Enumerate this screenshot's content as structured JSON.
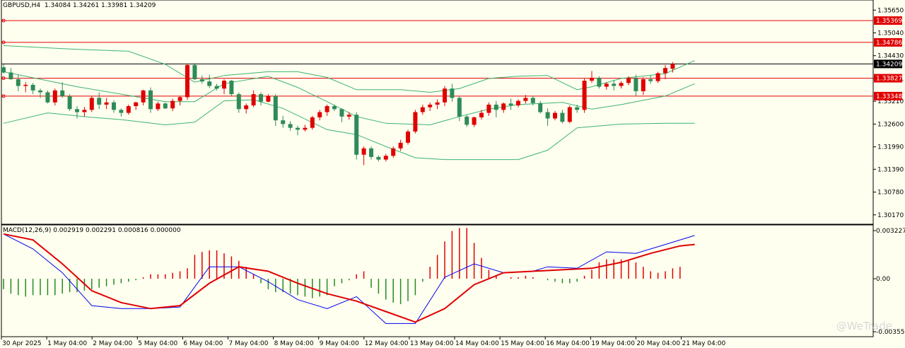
{
  "chart_data": {
    "type": "candlestick",
    "symbol_header": "GBPUSD,H4  1.34084 1.34261 1.33981 1.34209",
    "price_ticks": [
      "1.35650",
      "1.35040",
      "1.34430",
      "1.33821",
      "1.33210",
      "1.32600",
      "1.31990",
      "1.31390",
      "1.30780",
      "1.30170"
    ],
    "price_range": [
      1.2992,
      1.3592
    ],
    "x_labels": [
      "30 Apr 2025",
      "1 May 04:00",
      "2 May 04:00",
      "5 May 04:00",
      "6 May 04:00",
      "7 May 04:00",
      "8 May 04:00",
      "9 May 04:00",
      "12 May 04:00",
      "13 May 04:00",
      "14 May 04:00",
      "15 May 04:00",
      "16 May 04:00",
      "19 May 04:00",
      "20 May 04:00",
      "21 May 04:00"
    ],
    "horizontal_lines": [
      {
        "price": 1.35369,
        "label": "1.35369",
        "color": "#e00000"
      },
      {
        "price": 1.34786,
        "label": "1.34786",
        "color": "#e00000"
      },
      {
        "price": 1.33827,
        "label": "1.33827",
        "color": "#e00000"
      },
      {
        "price": 1.33348,
        "label": "1.33348",
        "color": "#e00000"
      }
    ],
    "current_price": {
      "price": 1.34209,
      "label": "1.34209"
    },
    "colors": {
      "bull": "#e00000",
      "bear": "#2e8b57",
      "band": "#3cb371",
      "macd_line": "#0000ee",
      "signal_line": "#e00000"
    },
    "candles": [
      [
        1.3412,
        1.342,
        1.3395,
        1.3398
      ],
      [
        1.3398,
        1.341,
        1.3378,
        1.338
      ],
      [
        1.338,
        1.3392,
        1.3348,
        1.3362
      ],
      [
        1.3362,
        1.3372,
        1.3345,
        1.3365
      ],
      [
        1.3365,
        1.337,
        1.334,
        1.335
      ],
      [
        1.335,
        1.3355,
        1.333,
        1.3345
      ],
      [
        1.3345,
        1.335,
        1.3315,
        1.3318
      ],
      [
        1.3318,
        1.3355,
        1.331,
        1.335
      ],
      [
        1.335,
        1.3372,
        1.333,
        1.3335
      ],
      [
        1.3335,
        1.334,
        1.3295,
        1.33
      ],
      [
        1.33,
        1.3308,
        1.3275,
        1.3292
      ],
      [
        1.3292,
        1.3306,
        1.328,
        1.3298
      ],
      [
        1.3298,
        1.3335,
        1.3292,
        1.333
      ],
      [
        1.333,
        1.3345,
        1.33,
        1.3312
      ],
      [
        1.3312,
        1.333,
        1.33,
        1.3318
      ],
      [
        1.3318,
        1.3324,
        1.329,
        1.3298
      ],
      [
        1.3298,
        1.3302,
        1.328,
        1.329
      ],
      [
        1.329,
        1.3312,
        1.3285,
        1.3308
      ],
      [
        1.3308,
        1.332,
        1.3298,
        1.3318
      ],
      [
        1.3318,
        1.3352,
        1.331,
        1.335
      ],
      [
        1.335,
        1.3358,
        1.329,
        1.33
      ],
      [
        1.33,
        1.332,
        1.3295,
        1.3315
      ],
      [
        1.3315,
        1.3318,
        1.33,
        1.3302
      ],
      [
        1.3302,
        1.3328,
        1.3295,
        1.3322
      ],
      [
        1.3322,
        1.3335,
        1.331,
        1.3332
      ],
      [
        1.3332,
        1.3422,
        1.3325,
        1.3418
      ],
      [
        1.3418,
        1.342,
        1.3378,
        1.338
      ],
      [
        1.338,
        1.339,
        1.3368,
        1.3374
      ],
      [
        1.3374,
        1.3392,
        1.3356,
        1.3362
      ],
      [
        1.3362,
        1.3368,
        1.335,
        1.3355
      ],
      [
        1.3355,
        1.338,
        1.334,
        1.3376
      ],
      [
        1.3376,
        1.3378,
        1.3335,
        1.334
      ],
      [
        1.334,
        1.3345,
        1.329,
        1.33
      ],
      [
        1.33,
        1.3315,
        1.3288,
        1.331
      ],
      [
        1.331,
        1.335,
        1.3305,
        1.334
      ],
      [
        1.334,
        1.3345,
        1.331,
        1.332
      ],
      [
        1.332,
        1.334,
        1.3318,
        1.3335
      ],
      [
        1.3335,
        1.334,
        1.3255,
        1.327
      ],
      [
        1.327,
        1.3282,
        1.325,
        1.326
      ],
      [
        1.326,
        1.3268,
        1.3242,
        1.325
      ],
      [
        1.325,
        1.3256,
        1.323,
        1.3245
      ],
      [
        1.3245,
        1.3258,
        1.324,
        1.325
      ],
      [
        1.325,
        1.3282,
        1.3245,
        1.3278
      ],
      [
        1.3278,
        1.3298,
        1.327,
        1.3292
      ],
      [
        1.3292,
        1.3312,
        1.3282,
        1.3308
      ],
      [
        1.3308,
        1.3312,
        1.3295,
        1.33
      ],
      [
        1.33,
        1.3302,
        1.3265,
        1.328
      ],
      [
        1.328,
        1.3292,
        1.3272,
        1.3285
      ],
      [
        1.3285,
        1.3292,
        1.3165,
        1.3178
      ],
      [
        1.3178,
        1.32,
        1.315,
        1.3195
      ],
      [
        1.3195,
        1.32,
        1.3165,
        1.3172
      ],
      [
        1.3172,
        1.3176,
        1.316,
        1.3165
      ],
      [
        1.3165,
        1.318,
        1.316,
        1.3175
      ],
      [
        1.3175,
        1.32,
        1.317,
        1.3195
      ],
      [
        1.3195,
        1.3218,
        1.3188,
        1.321
      ],
      [
        1.321,
        1.3245,
        1.3205,
        1.324
      ],
      [
        1.324,
        1.3298,
        1.3235,
        1.3292
      ],
      [
        1.3292,
        1.3312,
        1.3285,
        1.3305
      ],
      [
        1.3305,
        1.3318,
        1.3295,
        1.3312
      ],
      [
        1.3312,
        1.3326,
        1.33,
        1.3318
      ],
      [
        1.3318,
        1.3362,
        1.3308,
        1.3355
      ],
      [
        1.3355,
        1.3368,
        1.332,
        1.333
      ],
      [
        1.333,
        1.3335,
        1.3268,
        1.328
      ],
      [
        1.328,
        1.3285,
        1.3252,
        1.3258
      ],
      [
        1.3258,
        1.328,
        1.3252,
        1.3278
      ],
      [
        1.3278,
        1.3298,
        1.3272,
        1.329
      ],
      [
        1.329,
        1.3318,
        1.3282,
        1.3312
      ],
      [
        1.3312,
        1.3322,
        1.3278,
        1.3298
      ],
      [
        1.3298,
        1.3318,
        1.329,
        1.3315
      ],
      [
        1.3315,
        1.3328,
        1.3298,
        1.331
      ],
      [
        1.331,
        1.3326,
        1.3305,
        1.3322
      ],
      [
        1.3322,
        1.3338,
        1.3315,
        1.333
      ],
      [
        1.333,
        1.3335,
        1.331,
        1.3316
      ],
      [
        1.3316,
        1.3322,
        1.3288,
        1.3292
      ],
      [
        1.3292,
        1.3302,
        1.3255,
        1.3275
      ],
      [
        1.3275,
        1.3295,
        1.327,
        1.329
      ],
      [
        1.329,
        1.3298,
        1.3262,
        1.3266
      ],
      [
        1.3266,
        1.331,
        1.3262,
        1.3305
      ],
      [
        1.3305,
        1.3312,
        1.329,
        1.3298
      ],
      [
        1.3298,
        1.3382,
        1.329,
        1.3376
      ],
      [
        1.3376,
        1.3402,
        1.337,
        1.3384
      ],
      [
        1.3384,
        1.3388,
        1.3355,
        1.336
      ],
      [
        1.336,
        1.3372,
        1.3352,
        1.3368
      ],
      [
        1.3368,
        1.3378,
        1.335,
        1.3362
      ],
      [
        1.3362,
        1.3375,
        1.3355,
        1.337
      ],
      [
        1.337,
        1.3388,
        1.3364,
        1.3382
      ],
      [
        1.3382,
        1.3392,
        1.3336,
        1.3348
      ],
      [
        1.3348,
        1.3385,
        1.3338,
        1.338
      ],
      [
        1.338,
        1.339,
        1.3368,
        1.3375
      ],
      [
        1.3375,
        1.34,
        1.337,
        1.3396
      ],
      [
        1.3396,
        1.3418,
        1.338,
        1.341
      ],
      [
        1.3408,
        1.3426,
        1.3398,
        1.3421
      ]
    ],
    "bollinger": {
      "upper": [
        [
          0,
          1.347
        ],
        [
          10,
          1.346
        ],
        [
          17,
          1.3455
        ],
        [
          22,
          1.342
        ],
        [
          26,
          1.3372
        ],
        [
          30,
          1.339
        ],
        [
          36,
          1.34
        ],
        [
          40,
          1.34
        ],
        [
          44,
          1.3385
        ],
        [
          48,
          1.3352
        ],
        [
          54,
          1.3352
        ],
        [
          58,
          1.3345
        ],
        [
          62,
          1.3355
        ],
        [
          66,
          1.3382
        ],
        [
          70,
          1.3388
        ],
        [
          74,
          1.339
        ],
        [
          78,
          1.3352
        ],
        [
          80,
          1.336
        ],
        [
          84,
          1.3382
        ],
        [
          90,
          1.3395
        ],
        [
          94,
          1.343
        ]
      ],
      "middle": [
        [
          0,
          1.34
        ],
        [
          10,
          1.336
        ],
        [
          16,
          1.334
        ],
        [
          22,
          1.332
        ],
        [
          26,
          1.332
        ],
        [
          30,
          1.3368
        ],
        [
          36,
          1.3388
        ],
        [
          40,
          1.3358
        ],
        [
          44,
          1.332
        ],
        [
          48,
          1.328
        ],
        [
          52,
          1.3262
        ],
        [
          58,
          1.3258
        ],
        [
          62,
          1.328
        ],
        [
          66,
          1.33
        ],
        [
          70,
          1.3312
        ],
        [
          76,
          1.3318
        ],
        [
          80,
          1.33
        ],
        [
          84,
          1.3312
        ],
        [
          90,
          1.3335
        ],
        [
          94,
          1.3368
        ]
      ],
      "lower": [
        [
          0,
          1.3262
        ],
        [
          6,
          1.329
        ],
        [
          12,
          1.3278
        ],
        [
          16,
          1.3272
        ],
        [
          22,
          1.3258
        ],
        [
          26,
          1.3265
        ],
        [
          30,
          1.3322
        ],
        [
          34,
          1.3325
        ],
        [
          38,
          1.3302
        ],
        [
          44,
          1.3245
        ],
        [
          48,
          1.3232
        ],
        [
          52,
          1.32
        ],
        [
          56,
          1.317
        ],
        [
          60,
          1.3165
        ],
        [
          66,
          1.3165
        ],
        [
          70,
          1.3165
        ],
        [
          74,
          1.319
        ],
        [
          78,
          1.325
        ],
        [
          84,
          1.326
        ],
        [
          90,
          1.3262
        ],
        [
          94,
          1.3262
        ]
      ]
    },
    "macd": {
      "header": "MACD(12,26,9) 0.002919 0.002291 0.000816 0.000000",
      "ticks": [
        "0.003227",
        "0.00",
        "-0.003551"
      ],
      "range": [
        -0.003551,
        0.003227
      ],
      "histogram": [
        -0.0007,
        -0.001,
        -0.0011,
        -0.0012,
        -0.0011,
        -0.0011,
        -0.0011,
        -0.0011,
        -0.001,
        -0.0009,
        -0.0009,
        -0.0008,
        -0.0007,
        -0.0006,
        -0.0005,
        -0.0004,
        -0.0003,
        -0.0002,
        -0.0001,
        0.0001,
        0.0003,
        0.0003,
        0.0003,
        0.0004,
        0.0005,
        0.0007,
        0.0016,
        0.0018,
        0.0019,
        0.0019,
        0.0017,
        0.0015,
        0.0012,
        0.0008,
        0.0003,
        -0.0003,
        -0.0007,
        -0.0009,
        -0.0009,
        -0.001,
        -0.0011,
        -0.0012,
        -0.0013,
        -0.0012,
        -0.0011,
        -0.0005,
        -0.0003,
        -0.0001,
        0.0003,
        0.0005,
        -0.0006,
        -0.001,
        -0.0014,
        -0.0016,
        -0.0017,
        -0.0015,
        -0.0011,
        -0.0002,
        0.0008,
        0.0016,
        0.0025,
        0.0032,
        0.0034,
        0.0034,
        0.0024,
        0.0014,
        0.0006,
        0.0002,
        0.0,
        0.0001,
        0.0001,
        0.0002,
        0.0001,
        0.0,
        -0.0001,
        -0.0002,
        -0.0003,
        -0.0003,
        -0.0002,
        0.0002,
        0.0006,
        0.0011,
        0.0013,
        0.0013,
        0.0013,
        0.0012,
        0.0011,
        0.0008,
        0.0005,
        0.0004,
        0.0005,
        0.0007,
        0.0008
      ],
      "macd_line": [
        [
          0,
          0.003
        ],
        [
          4,
          0.002
        ],
        [
          8,
          0.0004
        ],
        [
          12,
          -0.0018
        ],
        [
          16,
          -0.002
        ],
        [
          20,
          -0.002
        ],
        [
          24,
          -0.0019
        ],
        [
          28,
          0.0008
        ],
        [
          32,
          0.0008
        ],
        [
          36,
          -0.0002
        ],
        [
          40,
          -0.0014
        ],
        [
          44,
          -0.002
        ],
        [
          48,
          -0.0012
        ],
        [
          52,
          -0.003
        ],
        [
          56,
          -0.003
        ],
        [
          60,
          0.0001
        ],
        [
          64,
          0.001
        ],
        [
          68,
          0.0004
        ],
        [
          72,
          0.0005
        ],
        [
          74,
          0.0008
        ],
        [
          78,
          0.0007
        ],
        [
          82,
          0.0018
        ],
        [
          86,
          0.0017
        ],
        [
          90,
          0.0023
        ],
        [
          94,
          0.0029
        ]
      ],
      "signal_line": [
        [
          0,
          0.003
        ],
        [
          4,
          0.0026
        ],
        [
          8,
          0.001
        ],
        [
          12,
          -0.0008
        ],
        [
          16,
          -0.0016
        ],
        [
          20,
          -0.002
        ],
        [
          24,
          -0.0018
        ],
        [
          28,
          -0.0003
        ],
        [
          32,
          0.0008
        ],
        [
          36,
          0.0005
        ],
        [
          40,
          -0.0003
        ],
        [
          44,
          -0.001
        ],
        [
          48,
          -0.0015
        ],
        [
          52,
          -0.0022
        ],
        [
          56,
          -0.0029
        ],
        [
          60,
          -0.002
        ],
        [
          64,
          -0.0004
        ],
        [
          68,
          0.0004
        ],
        [
          72,
          0.0005
        ],
        [
          76,
          0.0006
        ],
        [
          80,
          0.0007
        ],
        [
          84,
          0.0011
        ],
        [
          88,
          0.0017
        ],
        [
          92,
          0.0022
        ],
        [
          94,
          0.0023
        ]
      ]
    },
    "watermark": "@WeTrade"
  }
}
